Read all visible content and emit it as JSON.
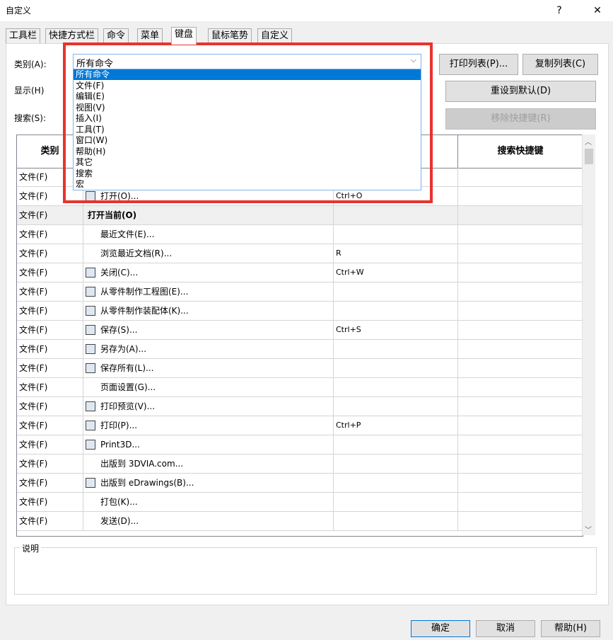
{
  "window": {
    "title": "自定义",
    "help_label": "?",
    "close_label": "✕"
  },
  "tabs": [
    "工具栏",
    "快捷方式栏",
    "命令",
    "菜单",
    "键盘",
    "鼠标笔势",
    "自定义"
  ],
  "labels": {
    "category": "类别(A):",
    "show": "显示(H)",
    "search": "搜索(S):",
    "description": "说明"
  },
  "category_select": {
    "value": "所有命令",
    "options": [
      "所有命令",
      "文件(F)",
      "编辑(E)",
      "视图(V)",
      "插入(I)",
      "工具(T)",
      "窗口(W)",
      "帮助(H)",
      "其它",
      "搜索",
      "宏"
    ],
    "selected_index": 0
  },
  "buttons": {
    "print_list": "打印列表(P)...",
    "copy_list": "复制列表(C)",
    "reset_default": "重设到默认(D)",
    "remove_shortcut": "移除快捷键(R)",
    "ok": "确定",
    "cancel": "取消",
    "help": "帮助(H)"
  },
  "table": {
    "headers": [
      "类别",
      "",
      "",
      "搜索快捷键"
    ],
    "rows": [
      {
        "category": "文件(F)",
        "command": "",
        "shortcut": "",
        "icon": ""
      },
      {
        "category": "文件(F)",
        "command": "打开(O)...",
        "shortcut": "Ctrl+O",
        "icon": "open-icon"
      },
      {
        "category": "文件(F)",
        "command": "打开当前(O)",
        "shortcut": "",
        "icon": "",
        "group": true
      },
      {
        "category": "文件(F)",
        "command": "最近文件(E)...",
        "shortcut": "",
        "icon": ""
      },
      {
        "category": "文件(F)",
        "command": "浏览最近文档(R)...",
        "shortcut": "R",
        "icon": ""
      },
      {
        "category": "文件(F)",
        "command": "关闭(C)...",
        "shortcut": "Ctrl+W",
        "icon": "close-doc-icon"
      },
      {
        "category": "文件(F)",
        "command": "从零件制作工程图(E)...",
        "shortcut": "",
        "icon": "drawing-icon"
      },
      {
        "category": "文件(F)",
        "command": "从零件制作装配体(K)...",
        "shortcut": "",
        "icon": "assembly-icon"
      },
      {
        "category": "文件(F)",
        "command": "保存(S)...",
        "shortcut": "Ctrl+S",
        "icon": "save-icon"
      },
      {
        "category": "文件(F)",
        "command": "另存为(A)...",
        "shortcut": "",
        "icon": "save-as-icon"
      },
      {
        "category": "文件(F)",
        "command": "保存所有(L)...",
        "shortcut": "",
        "icon": "save-all-icon"
      },
      {
        "category": "文件(F)",
        "command": "页面设置(G)...",
        "shortcut": "",
        "icon": ""
      },
      {
        "category": "文件(F)",
        "command": "打印预览(V)...",
        "shortcut": "",
        "icon": "print-preview-icon"
      },
      {
        "category": "文件(F)",
        "command": "打印(P)...",
        "shortcut": "Ctrl+P",
        "icon": "print-icon"
      },
      {
        "category": "文件(F)",
        "command": "Print3D...",
        "shortcut": "",
        "icon": "print3d-icon"
      },
      {
        "category": "文件(F)",
        "command": "出版到 3DVIA.com...",
        "shortcut": "",
        "icon": ""
      },
      {
        "category": "文件(F)",
        "command": "出版到 eDrawings(B)...",
        "shortcut": "",
        "icon": "edrawings-icon"
      },
      {
        "category": "文件(F)",
        "command": "打包(K)...",
        "shortcut": "",
        "icon": ""
      },
      {
        "category": "文件(F)",
        "command": "发送(D)...",
        "shortcut": "",
        "icon": ""
      }
    ]
  }
}
